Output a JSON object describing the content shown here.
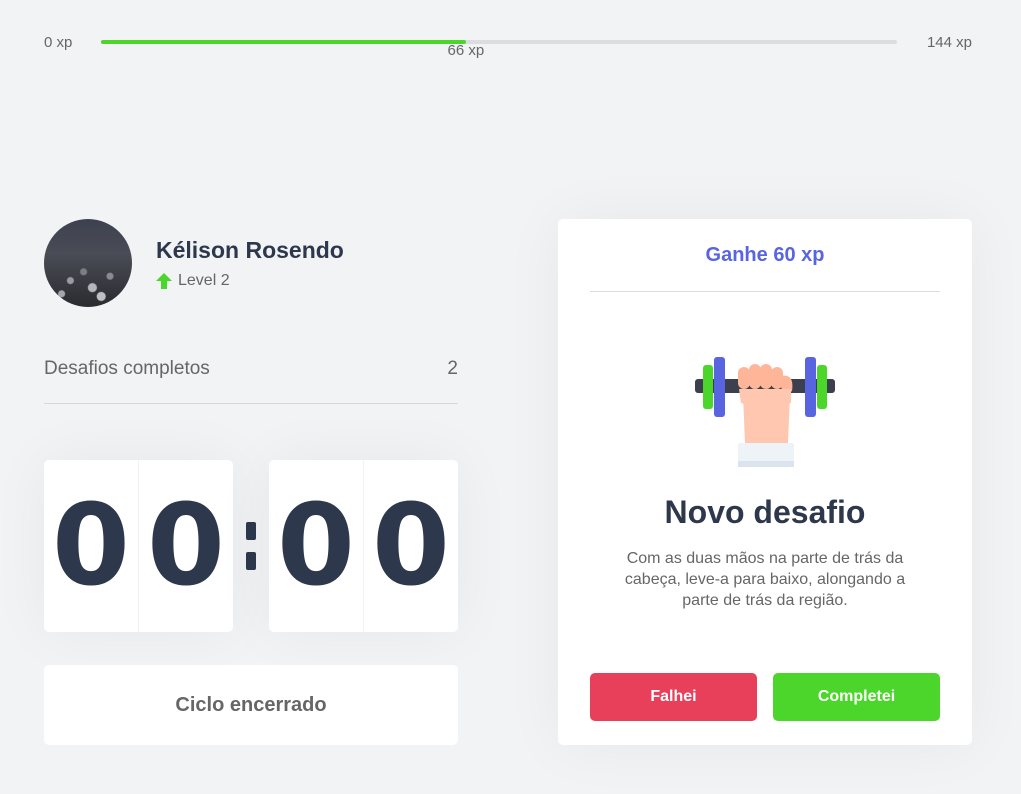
{
  "xp": {
    "min_label": "0 xp",
    "max_label": "144 xp",
    "current_label": "66 xp",
    "current": 66,
    "max": 144
  },
  "profile": {
    "name": "Kélison Rosendo",
    "level_label": "Level 2"
  },
  "completed": {
    "label": "Desafios completos",
    "count": "2"
  },
  "countdown": {
    "minutes": [
      "0",
      "0"
    ],
    "separator": ":",
    "seconds": [
      "0",
      "0"
    ]
  },
  "cycle_button": {
    "label": "Ciclo encerrado"
  },
  "challenge": {
    "reward": "Ganhe 60 xp",
    "icon": "dumbbell-icon",
    "title": "Novo desafio",
    "description": "Com as duas mãos na parte de trás da cabeça, leve-a para baixo, alongando a parte de trás da região.",
    "fail_label": "Falhei",
    "success_label": "Completei"
  },
  "colors": {
    "green": "#4cd62b",
    "red": "#e83f5b",
    "blue": "#5965e0",
    "title": "#2e384d",
    "text": "#666666",
    "background": "#f2f3f5"
  }
}
